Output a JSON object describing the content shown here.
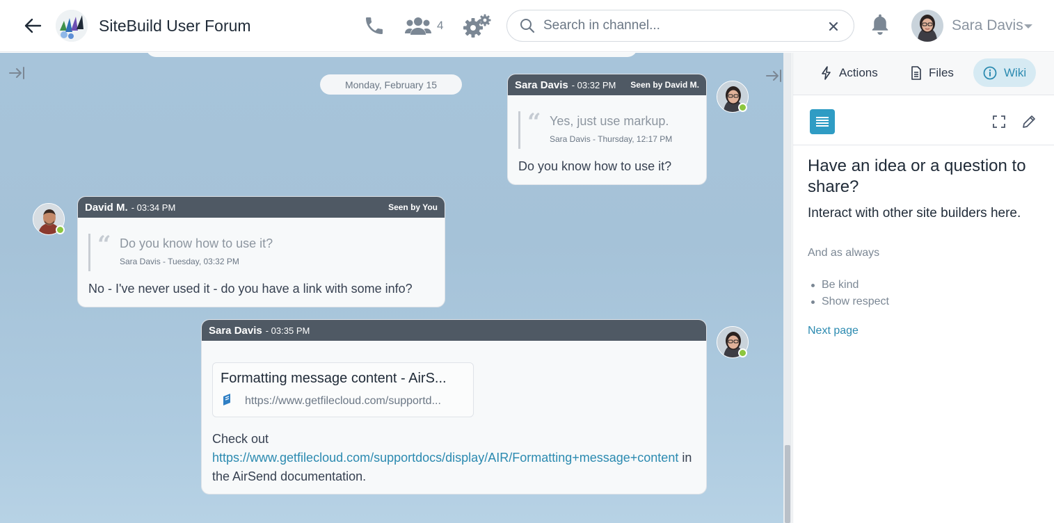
{
  "header": {
    "channel_title": "SiteBuild User Forum",
    "member_count": "4",
    "search_placeholder": "Search in channel...",
    "user_name": "Sara Davis"
  },
  "chat": {
    "date_separator": "Monday, February 15",
    "messages": [
      {
        "author": "Sara Davis",
        "time": "- 03:32 PM",
        "seen": "Seen by David M.",
        "quote_text": "Yes, just use markup.",
        "quote_meta": "Sara Davis - Thursday, 12:17 PM",
        "body": "Do you know how to use it?"
      },
      {
        "author": "David M.",
        "time": "- 03:34 PM",
        "seen": "Seen by You",
        "quote_text": "Do you know how to use it?",
        "quote_meta": "Sara Davis - Tuesday, 03:32 PM",
        "body": "No - I've never used it - do you have a link with some info?"
      },
      {
        "author": "Sara Davis",
        "time": "- 03:35 PM",
        "link_title": "Formatting message content - AirS...",
        "link_url": "https://www.getfilecloud.com/supportd...",
        "body_prefix": "Check out",
        "body_link": "https://www.getfilecloud.com/supportdocs/display/AIR/Formatting+message+content",
        "body_suffix": " in the AirSend documentation."
      }
    ]
  },
  "panel": {
    "tabs": [
      {
        "label": "Actions",
        "active": false
      },
      {
        "label": "Files",
        "active": false
      },
      {
        "label": "Wiki",
        "active": true
      }
    ],
    "wiki": {
      "heading": "Have an idea or a question to share?",
      "subheading": "Interact with other site builders here.",
      "paragraph": "And as always",
      "bullets": [
        "Be kind",
        "Show respect"
      ],
      "next_link": "Next page"
    }
  },
  "colors": {
    "accent": "#2b8ab0",
    "message_header": "#4f5964",
    "online_status": "#8cc63f",
    "chat_background": "#a7c4da"
  }
}
